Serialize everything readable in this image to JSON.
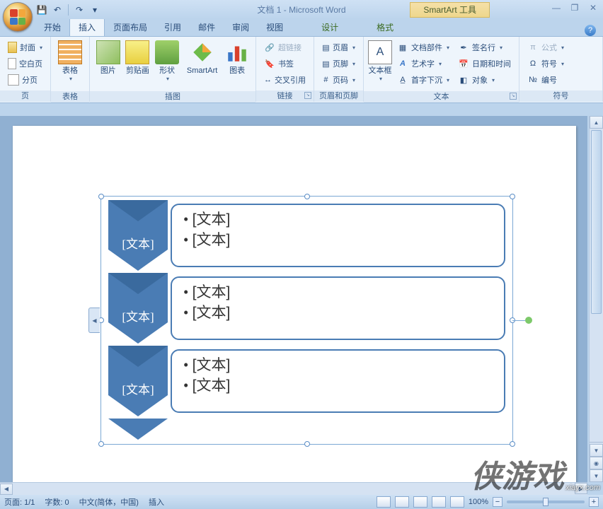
{
  "title": "文档 1 - Microsoft Word",
  "contextTab": "SmartArt 工具",
  "windowControls": {
    "min": "—",
    "restore": "❐",
    "close": "✕"
  },
  "qat": {
    "save": "💾",
    "undo": "↶",
    "redo": "↷"
  },
  "tabs": {
    "start": "开始",
    "insert": "插入",
    "layout": "页面布局",
    "refs": "引用",
    "mail": "邮件",
    "review": "审阅",
    "view": "视图",
    "design": "设计",
    "format": "格式"
  },
  "ribbon": {
    "pages": {
      "label": "页",
      "cover": "封面",
      "blank": "空白页",
      "break": "分页"
    },
    "tables": {
      "label": "表格",
      "table": "表格"
    },
    "illus": {
      "label": "插图",
      "picture": "图片",
      "clip": "剪贴画",
      "shapes": "形状",
      "smartart": "SmartArt",
      "chart": "图表"
    },
    "links": {
      "label": "链接",
      "hyper": "超链接",
      "bookmark": "书签",
      "xref": "交叉引用"
    },
    "headerfooter": {
      "label": "页眉和页脚",
      "header": "页眉",
      "footer": "页脚",
      "pagenum": "页码"
    },
    "text": {
      "label": "文本",
      "textbox": "文本框",
      "parts": "文档部件",
      "wordart": "艺术字",
      "dropcap": "首字下沉",
      "sig": "签名行",
      "datetime": "日期和时间",
      "object": "对象"
    },
    "symbols": {
      "label": "符号",
      "equation": "公式",
      "symbol": "符号",
      "number": "编号"
    }
  },
  "smartart": {
    "placeholder": "[文本]",
    "rows": [
      {
        "head": "[文本]",
        "bullets": [
          "[文本]",
          "[文本]"
        ]
      },
      {
        "head": "[文本]",
        "bullets": [
          "[文本]",
          "[文本]"
        ]
      },
      {
        "head": "[文本]",
        "bullets": [
          "[文本]",
          "[文本]"
        ]
      }
    ]
  },
  "status": {
    "page": "页面: 1/1",
    "words": "字数: 0",
    "lang": "中文(简体，中国)",
    "mode": "插入",
    "zoom": "100%"
  },
  "watermark": {
    "site": "xiayx.com",
    "text": "侠游戏"
  }
}
